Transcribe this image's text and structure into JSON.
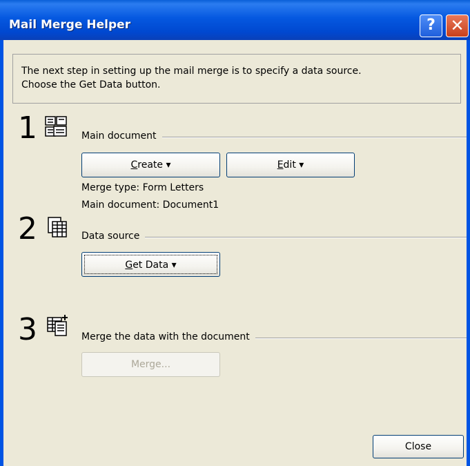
{
  "window": {
    "title": "Mail Merge Helper",
    "help_glyph": "?",
    "close_glyph": "✕"
  },
  "instructions": {
    "line1": "The next step in setting up the mail merge is to specify a data source.",
    "line2": "Choose the Get Data button."
  },
  "steps": [
    {
      "number": "1",
      "icon": "main-document-icon",
      "label": "Main document",
      "buttons": {
        "create": {
          "mnemonic": "C",
          "rest": "reate",
          "arrow": "▾"
        },
        "edit": {
          "mnemonic": "E",
          "rest": "dit",
          "arrow": "▾"
        }
      },
      "info1": "Merge type: Form Letters",
      "info2": "Main document: Document1"
    },
    {
      "number": "2",
      "icon": "data-source-icon",
      "label": "Data source",
      "buttons": {
        "get_data": {
          "mnemonic": "G",
          "rest": "et Data",
          "arrow": "▾"
        }
      }
    },
    {
      "number": "3",
      "icon": "merge-icon",
      "label": "Merge the data with the document",
      "buttons": {
        "merge": {
          "label": "Merge..."
        }
      }
    }
  ],
  "footer": {
    "close_label": "Close"
  },
  "colors": {
    "titlebar": "#0054e3",
    "dialog_bg": "#ece9d8",
    "disabled_text": "#aca899"
  }
}
